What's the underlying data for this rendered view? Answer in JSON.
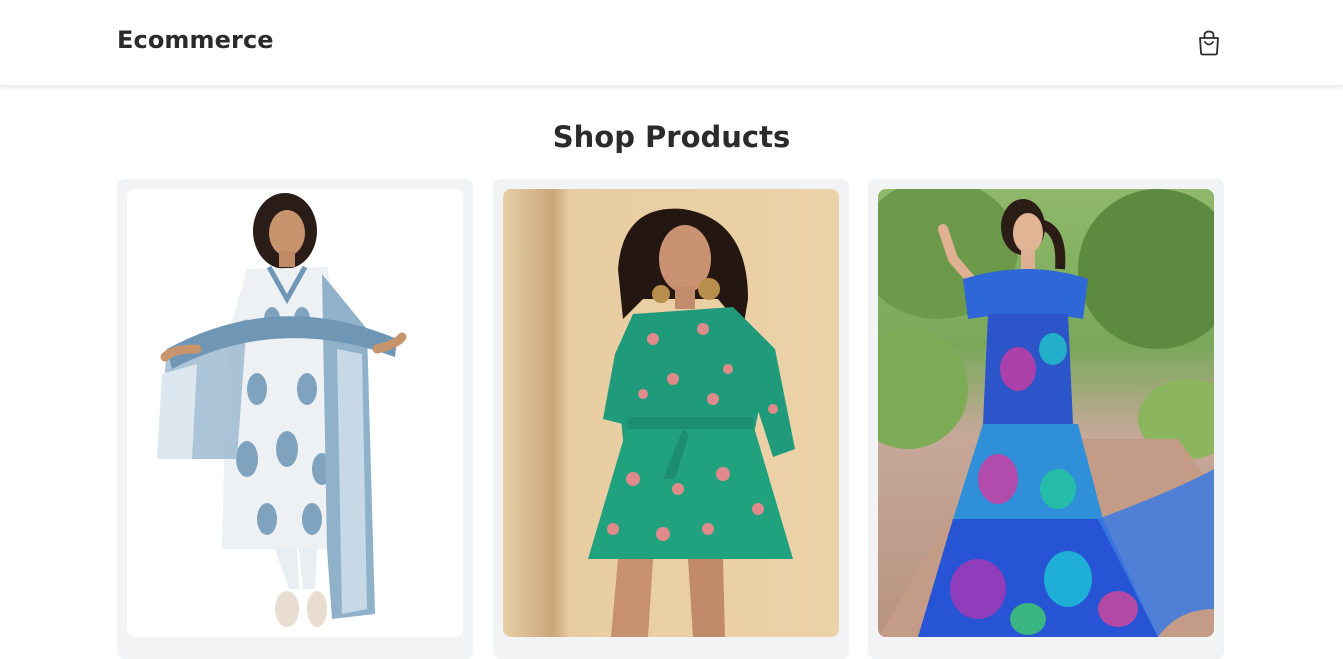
{
  "navbar": {
    "brand": "Ecommerce",
    "cart_icon": "shopping-bag-icon"
  },
  "page": {
    "title": "Shop Products"
  },
  "products": [
    {
      "image": "woman in white and blue block-print kurta set with dupatta"
    },
    {
      "image": "woman in green floral wrap mini dress"
    },
    {
      "image": "woman in blue multicolour tiered maxi dress"
    }
  ],
  "colors": {
    "text": "#2b2b2b",
    "card_bg": "#f2f3f5"
  }
}
